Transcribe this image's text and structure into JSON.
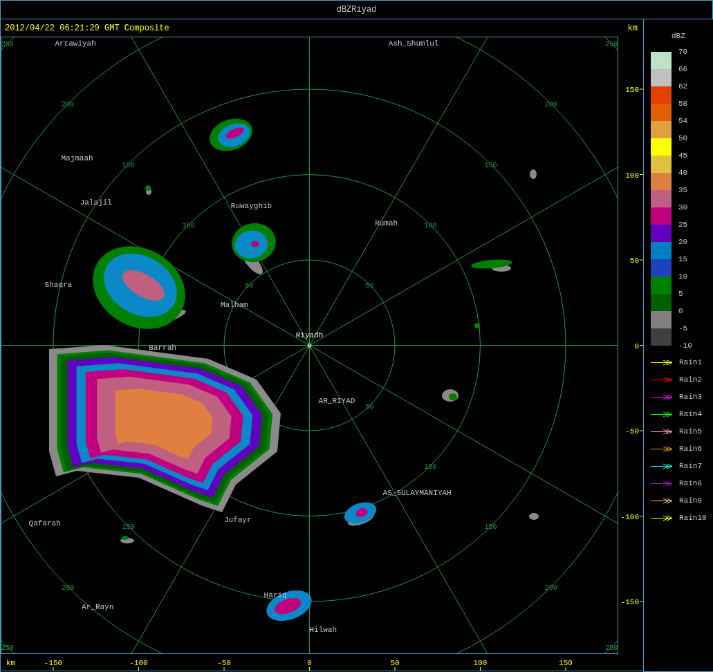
{
  "window": {
    "title": "dBZRiyad"
  },
  "header": {
    "timestamp": "2012/04/22 06:21:29 GMT Composite",
    "unit": "km"
  },
  "map": {
    "site": {
      "name": "Riyadh",
      "marker": "R"
    },
    "range_labels": [
      "50",
      "50",
      "50",
      "100",
      "100",
      "100",
      "150",
      "150",
      "150",
      "150",
      "200",
      "200",
      "200",
      "200",
      "250",
      "250",
      "250",
      "250"
    ],
    "places": [
      "Artawiyah",
      "Ash_Shumlul",
      "Majmaah",
      "Jalajil",
      "Ruwayghib",
      "Rumah",
      "Shaqra",
      "Malham",
      "Barrah",
      "AR_RIYAD",
      "AS_SULAYMANIYAH",
      "Jufayr",
      "Qafarah",
      "Hariq",
      "Ar_Rayn",
      "Hilwah"
    ]
  },
  "y_axis": {
    "ticks": [
      "150",
      "100",
      "50",
      "0",
      "-50",
      "-100",
      "-150"
    ]
  },
  "x_axis": {
    "unit": "km",
    "ticks": [
      "-150",
      "-100",
      "-50",
      "0",
      "50",
      "100",
      "150"
    ]
  },
  "legend": {
    "title": "dBZ",
    "bottom_label": "-10",
    "bins": [
      {
        "label": "70",
        "color": "#c0e0c8"
      },
      {
        "label": "66",
        "color": "#c0c0c0"
      },
      {
        "label": "62",
        "color": "#e04000"
      },
      {
        "label": "58",
        "color": "#e06000"
      },
      {
        "label": "54",
        "color": "#e0a040"
      },
      {
        "label": "50",
        "color": "#ffff00"
      },
      {
        "label": "45",
        "color": "#e0c040"
      },
      {
        "label": "40",
        "color": "#e08040"
      },
      {
        "label": "35",
        "color": "#c06080"
      },
      {
        "label": "30",
        "color": "#c0007f"
      },
      {
        "label": "25",
        "color": "#6000c0"
      },
      {
        "label": "20",
        "color": "#0080c0"
      },
      {
        "label": "15",
        "color": "#2040c0"
      },
      {
        "label": "10",
        "color": "#008000"
      },
      {
        "label": "5",
        "color": "#006000"
      },
      {
        "label": "0",
        "color": "#808080"
      },
      {
        "label": "-5",
        "color": "#404040"
      }
    ],
    "tracks": [
      {
        "name": "Rain1",
        "color": "#ffff00"
      },
      {
        "name": "Rain2",
        "color": "#ff0000"
      },
      {
        "name": "Rain3",
        "color": "#ff00ff"
      },
      {
        "name": "Rain4",
        "color": "#00ff00"
      },
      {
        "name": "Rain5",
        "color": "#ffa0c0"
      },
      {
        "name": "Rain6",
        "color": "#e0a000"
      },
      {
        "name": "Rain7",
        "color": "#00ffff"
      },
      {
        "name": "Rain8",
        "color": "#a020c0"
      },
      {
        "name": "Rain9",
        "color": "#f0c080"
      },
      {
        "name": "Rain10",
        "color": "#ffff00"
      }
    ]
  }
}
